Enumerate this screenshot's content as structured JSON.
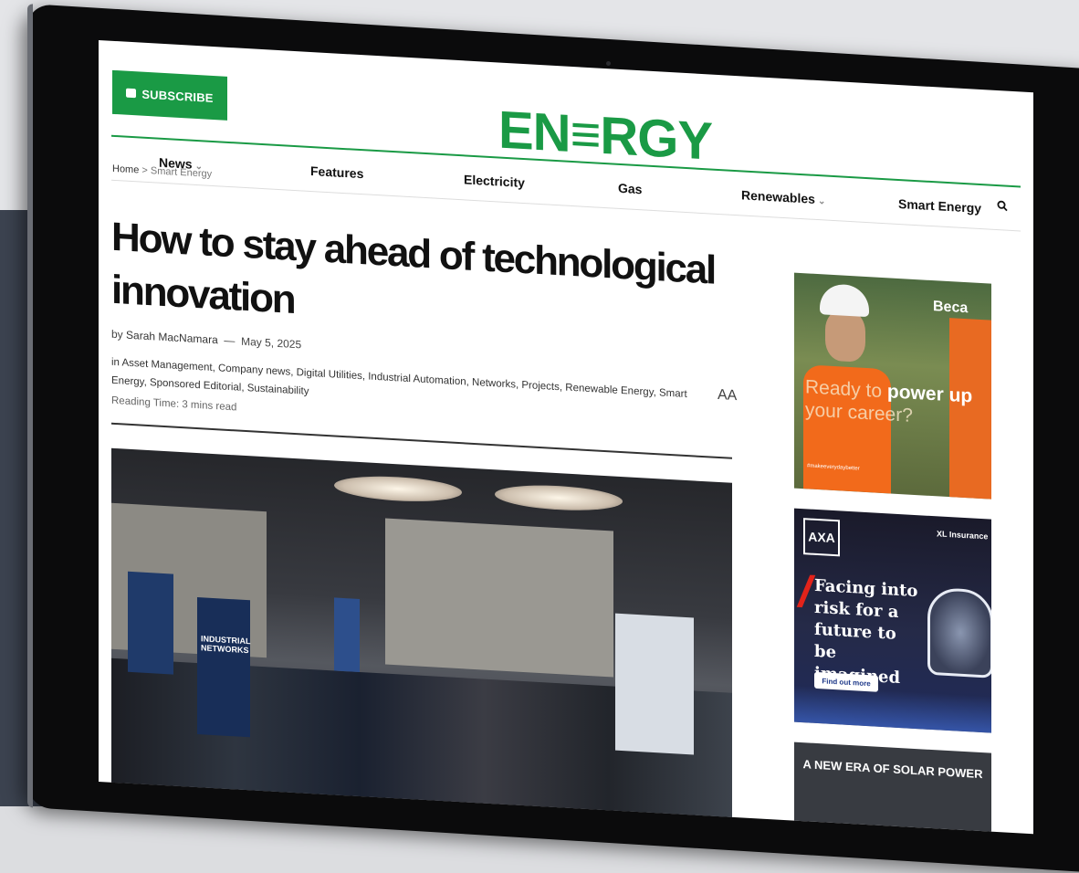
{
  "subscribe": {
    "label": "SUBSCRIBE"
  },
  "logo": {
    "text": "EN≡RGY"
  },
  "nav": [
    {
      "label": "News",
      "has_dropdown": true
    },
    {
      "label": "Features",
      "has_dropdown": false
    },
    {
      "label": "Electricity",
      "has_dropdown": false
    },
    {
      "label": "Gas",
      "has_dropdown": false
    },
    {
      "label": "Renewables",
      "has_dropdown": true
    },
    {
      "label": "Smart Energy",
      "has_dropdown": false
    }
  ],
  "breadcrumb": {
    "home": "Home",
    "separator": ">",
    "current": "Smart Energy"
  },
  "article": {
    "title": "How to stay ahead of technological innovation",
    "by_prefix": "by",
    "author": "Sarah MacNamara",
    "dash": "—",
    "date": "May 5, 2025",
    "categories": "in Asset Management, Company news, Digital Utilities, Industrial Automation, Networks, Projects, Renewable Energy, Smart Energy, Sponsored Editorial, Sustainability",
    "reading_time": "Reading Time: 3 mins read",
    "font_size_toggle": "AA"
  },
  "photo": {
    "booth_text_1": "INDUSTRIAL NETWORKS"
  },
  "ads": {
    "beca": {
      "brand": "Beca",
      "headline_dim": "Ready to",
      "headline_bold": "power up",
      "headline_end": "your career?",
      "tag": "#makeeverydaybetter"
    },
    "axa": {
      "logo": "AXA",
      "brand": "XL Insurance",
      "headline": "Facing into risk for a future to be imagined",
      "button": "Find out more"
    },
    "solar": {
      "headline": "A NEW ERA OF SOLAR POWER"
    }
  },
  "colors": {
    "brand_green": "#1a9a45",
    "axa_red": "#e2231a",
    "vest_orange": "#f26a1b"
  }
}
